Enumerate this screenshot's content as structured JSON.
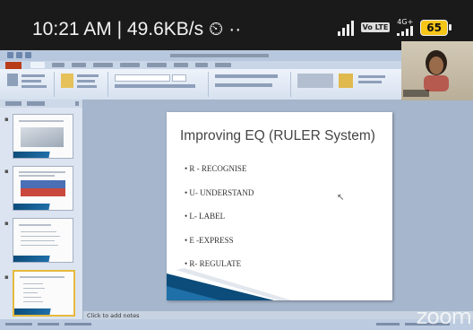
{
  "statusbar": {
    "time": "10:21 AM",
    "speed": "49.6KB/s",
    "separator": "|",
    "alarm_glyph": "⏲",
    "more_glyph": "··",
    "volte": "Vo LTE",
    "network": "4G+",
    "battery": "65"
  },
  "slide": {
    "title": "Improving EQ (RULER System)",
    "bullets": [
      "R - RECOGNISE",
      "U- UNDERSTAND",
      "L- LABEL",
      "E -EXPRESS",
      "R- REGULATE"
    ]
  },
  "notes": {
    "placeholder": "Click to add notes"
  },
  "zoom": {
    "logo": "zoom"
  },
  "colors": {
    "slide_accent": "#0b4c7a",
    "selected_thumb": "#e8b93d",
    "battery": "#f5c518"
  }
}
